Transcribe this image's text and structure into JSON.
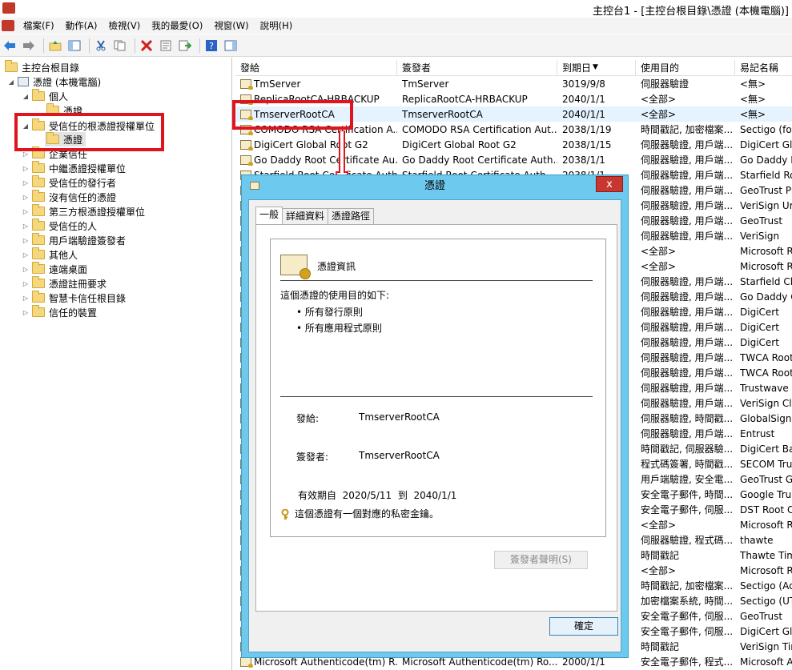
{
  "window": {
    "title": "主控台1 - [主控台根目錄\\憑證 (本機電腦)]"
  },
  "menu": [
    "檔案(F)",
    "動作(A)",
    "檢視(V)",
    "我的最愛(O)",
    "視窗(W)",
    "說明(H)"
  ],
  "toolbar_icons": [
    "back-icon",
    "forward-icon",
    "up-folder-icon",
    "show-hide-tree-icon",
    "cut-icon",
    "copy-icon",
    "delete-icon",
    "properties-icon",
    "export-icon",
    "help-icon",
    "show-hide-action-icon"
  ],
  "tree": {
    "root": "主控台根目錄",
    "certs_local": "憑證 (本機電腦)",
    "personal": "個人",
    "personal_certs": "憑證",
    "trusted_root": "受信任的根憑證授權單位",
    "trusted_root_certs": "憑證",
    "enterprise_trust": "企業信任",
    "intermediate_ca": "中繼憑證授權單位",
    "trusted_publishers": "受信任的發行者",
    "untrusted": "沒有信任的憑證",
    "third_party_root": "第三方根憑證授權單位",
    "trusted_people": "受信任的人",
    "client_auth_issuers": "用戶端驗證簽發者",
    "other_people": "其他人",
    "remote_desktop": "遠端桌面",
    "cert_enrollment": "憑證註冊要求",
    "smart_card_root": "智慧卡信任根目錄",
    "trusted_devices": "信任的裝置"
  },
  "list": {
    "columns": [
      "發給",
      "簽發者",
      "到期日",
      "使用目的",
      "易記名稱"
    ],
    "rows": [
      {
        "issued_to": "TmServer",
        "issued_by": "TmServer",
        "expires": "3019/9/8",
        "purpose": "伺服器驗證",
        "name": "<無>"
      },
      {
        "issued_to": "ReplicaRootCA-HRBACKUP",
        "issued_by": "ReplicaRootCA-HRBACKUP",
        "expires": "2040/1/1",
        "purpose": "<全部>",
        "name": "<無>"
      },
      {
        "issued_to": "TmserverRootCA",
        "issued_by": "TmserverRootCA",
        "expires": "2040/1/1",
        "purpose": "<全部>",
        "name": "<無>"
      },
      {
        "issued_to": "COMODO RSA Certification A...",
        "issued_by": "COMODO RSA Certification Aut...",
        "expires": "2038/1/19",
        "purpose": "時間戳記, 加密檔案...",
        "name": "Sectigo (fo"
      },
      {
        "issued_to": "DigiCert Global Root G2",
        "issued_by": "DigiCert Global Root G2",
        "expires": "2038/1/15",
        "purpose": "伺服器驗證, 用戶端...",
        "name": "DigiCert Glo"
      },
      {
        "issued_to": "Go Daddy Root Certificate Au...",
        "issued_by": "Go Daddy Root Certificate Auth...",
        "expires": "2038/1/1",
        "purpose": "伺服器驗證, 用戶端...",
        "name": "Go Daddy I"
      },
      {
        "issued_to": "Starfield Root Certificate Auth...",
        "issued_by": "Starfield Root Certificate Auth...",
        "expires": "2038/1/1",
        "purpose": "伺服器驗證, 用戶端...",
        "name": "Starfield Ro"
      },
      {
        "issued_to": "",
        "issued_by": "",
        "expires": "",
        "purpose": "伺服器驗證, 用戶端...",
        "name": "GeoTrust Pr"
      },
      {
        "issued_to": "",
        "issued_by": "",
        "expires": "",
        "purpose": "伺服器驗證, 用戶端...",
        "name": "VeriSign Ur"
      },
      {
        "issued_to": "",
        "issued_by": "",
        "expires": "",
        "purpose": "伺服器驗證, 用戶端...",
        "name": "GeoTrust"
      },
      {
        "issued_to": "",
        "issued_by": "",
        "expires": "",
        "purpose": "伺服器驗證, 用戶端...",
        "name": "VeriSign"
      },
      {
        "issued_to": "",
        "issued_by": "",
        "expires": "",
        "purpose": "<全部>",
        "name": "Microsoft R"
      },
      {
        "issued_to": "",
        "issued_by": "",
        "expires": "",
        "purpose": "<全部>",
        "name": "Microsoft R"
      },
      {
        "issued_to": "",
        "issued_by": "",
        "expires": "",
        "purpose": "伺服器驗證, 用戶端...",
        "name": "Starfield Cla"
      },
      {
        "issued_to": "",
        "issued_by": "",
        "expires": "",
        "purpose": "伺服器驗證, 用戶端...",
        "name": "Go Daddy C"
      },
      {
        "issued_to": "",
        "issued_by": "",
        "expires": "",
        "purpose": "伺服器驗證, 用戶端...",
        "name": "DigiCert"
      },
      {
        "issued_to": "",
        "issued_by": "",
        "expires": "",
        "purpose": "伺服器驗證, 用戶端...",
        "name": "DigiCert"
      },
      {
        "issued_to": "",
        "issued_by": "",
        "expires": "",
        "purpose": "伺服器驗證, 用戶端...",
        "name": "DigiCert"
      },
      {
        "issued_to": "",
        "issued_by": "",
        "expires": "",
        "purpose": "伺服器驗證, 用戶端...",
        "name": "TWCA Root"
      },
      {
        "issued_to": "",
        "issued_by": "",
        "expires": "",
        "purpose": "伺服器驗證, 用戶端...",
        "name": "TWCA Root"
      },
      {
        "issued_to": "",
        "issued_by": "",
        "expires": "",
        "purpose": "伺服器驗證, 用戶端...",
        "name": "Trustwave"
      },
      {
        "issued_to": "",
        "issued_by": "",
        "expires": "",
        "purpose": "伺服器驗證, 用戶端...",
        "name": "VeriSign Cla"
      },
      {
        "issued_to": "",
        "issued_by": "",
        "expires": "",
        "purpose": "伺服器驗證, 時間戳...",
        "name": "GlobalSign"
      },
      {
        "issued_to": "",
        "issued_by": "",
        "expires": "",
        "purpose": "伺服器驗證, 用戶端...",
        "name": "Entrust"
      },
      {
        "issued_to": "",
        "issued_by": "",
        "expires": "",
        "purpose": "時間戳記, 伺服器驗...",
        "name": "DigiCert Ba"
      },
      {
        "issued_to": "",
        "issued_by": "",
        "expires": "",
        "purpose": "程式碼簽署, 時間戳...",
        "name": "SECOM Tru"
      },
      {
        "issued_to": "",
        "issued_by": "",
        "expires": "",
        "purpose": "用戶端驗證, 安全電...",
        "name": "GeoTrust Gl"
      },
      {
        "issued_to": "",
        "issued_by": "",
        "expires": "",
        "purpose": "安全電子郵件, 時間...",
        "name": "Google Tru"
      },
      {
        "issued_to": "",
        "issued_by": "",
        "expires": "",
        "purpose": "安全電子郵件, 伺服...",
        "name": "DST Root C"
      },
      {
        "issued_to": "",
        "issued_by": "",
        "expires": "",
        "purpose": "<全部>",
        "name": "Microsoft R"
      },
      {
        "issued_to": "",
        "issued_by": "",
        "expires": "",
        "purpose": "伺服器驗證, 程式碼...",
        "name": "thawte"
      },
      {
        "issued_to": "",
        "issued_by": "",
        "expires": "",
        "purpose": "時間戳記",
        "name": "Thawte Tim"
      },
      {
        "issued_to": "",
        "issued_by": "",
        "expires": "",
        "purpose": "<全部>",
        "name": "Microsoft R"
      },
      {
        "issued_to": "",
        "issued_by": "",
        "expires": "",
        "purpose": "時間戳記, 加密檔案...",
        "name": "Sectigo (Ac"
      },
      {
        "issued_to": "",
        "issued_by": "",
        "expires": "",
        "purpose": "加密檔案系統, 時間...",
        "name": "Sectigo (UT"
      },
      {
        "issued_to": "",
        "issued_by": "",
        "expires": "",
        "purpose": "安全電子郵件, 伺服...",
        "name": "GeoTrust"
      },
      {
        "issued_to": "",
        "issued_by": "",
        "expires": "",
        "purpose": "安全電子郵件, 伺服...",
        "name": "DigiCert Glo"
      },
      {
        "issued_to": "",
        "issued_by": "",
        "expires": "",
        "purpose": "時間戳記",
        "name": "VeriSign Tin"
      },
      {
        "issued_to": "Microsoft Authenticode(tm) R...",
        "issued_by": "Microsoft Authenticode(tm) Ro...",
        "expires": "2000/1/1",
        "purpose": "安全電子郵件, 程式...",
        "name": "Microsoft A"
      }
    ]
  },
  "dialog": {
    "title": "憑證",
    "close": "x",
    "tabs": [
      "一般",
      "詳細資料",
      "憑證路徑"
    ],
    "info_title": "憑證資訊",
    "purpose_heading": "這個憑證的使用目的如下:",
    "purposes": [
      "所有發行原則",
      "所有應用程式原則"
    ],
    "issued_to_label": "發給:",
    "issued_to_value": "TmserverRootCA",
    "issued_by_label": "簽發者:",
    "issued_by_value": "TmserverRootCA",
    "valid_from_label": "有效期自",
    "valid_from": "2020/5/11",
    "valid_to_label": "到",
    "valid_to": "2040/1/1",
    "private_key_note": "這個憑證有一個對應的私密金鑰。",
    "issuer_statement_button": "簽發者聲明(S)",
    "ok_button": "確定"
  },
  "colors": {
    "annotation_red": "#e0141e",
    "dialog_frame": "#6ec9ee",
    "close_red": "#c7372f"
  }
}
